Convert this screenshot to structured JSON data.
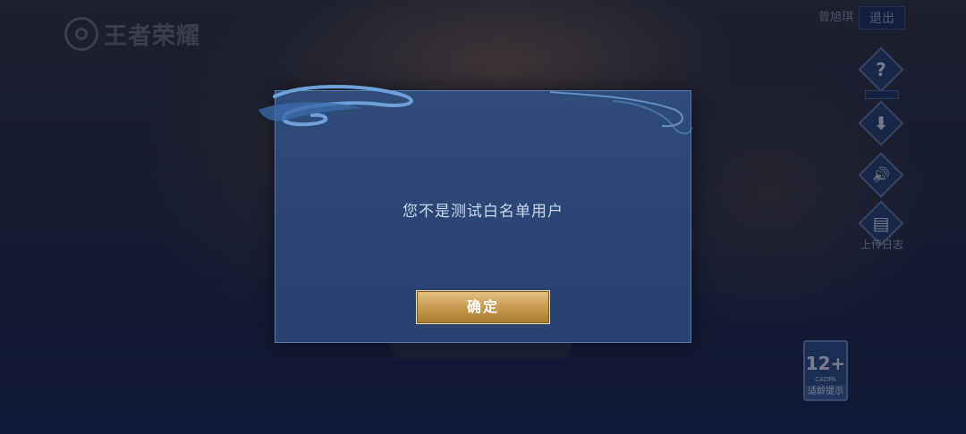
{
  "app": {
    "logo_text": "王者荣耀"
  },
  "header": {
    "username": "曾旭琪",
    "logout_label": "退出"
  },
  "side_menu": {
    "items": [
      {
        "icon": "question-icon",
        "glyph": "?"
      },
      {
        "icon": "download-icon",
        "glyph": "⬇"
      },
      {
        "icon": "speaker-icon",
        "glyph": "🔊"
      },
      {
        "icon": "document-icon",
        "glyph": "▤",
        "label": "上传日志"
      }
    ]
  },
  "age_rating": {
    "age": "12+",
    "org": "CADPA",
    "tip": "适龄提示"
  },
  "dialog": {
    "message": "您不是测试白名单用户",
    "confirm_label": "确定"
  },
  "colors": {
    "dialog_bg": "#2f4c7a",
    "button_gold": "#c79b4f",
    "dialog_text": "#c9d6ee"
  }
}
